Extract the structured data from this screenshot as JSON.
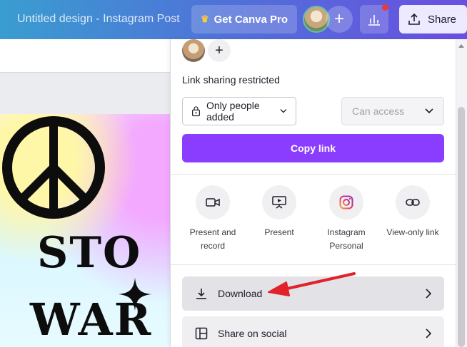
{
  "header": {
    "title": "Untitled design - Instagram Post",
    "pro_button": "Get Canva Pro",
    "share_button": "Share",
    "add_icon": "+"
  },
  "design": {
    "line1": "STO",
    "line2": "WAR"
  },
  "share_panel": {
    "add_icon": "+",
    "restricted_label": "Link sharing restricted",
    "people_select": "Only people added",
    "access_select_placeholder": "Can access",
    "copy_link": "Copy link",
    "options": [
      {
        "label_line1": "Present and",
        "label_line2": "record",
        "icon": "camera-icon"
      },
      {
        "label_line1": "Present",
        "label_line2": "",
        "icon": "present-icon"
      },
      {
        "label_line1": "Instagram",
        "label_line2": "Personal",
        "icon": "instagram-icon"
      },
      {
        "label_line1": "View-only link",
        "label_line2": "",
        "icon": "link-icon"
      }
    ],
    "rows": [
      {
        "label": "Download",
        "icon": "download-icon"
      },
      {
        "label": "Share on social",
        "icon": "layout-icon"
      }
    ]
  },
  "colors": {
    "accent": "#8b3dff",
    "annotation_arrow": "#e0232b",
    "crown": "#ffc93c"
  }
}
